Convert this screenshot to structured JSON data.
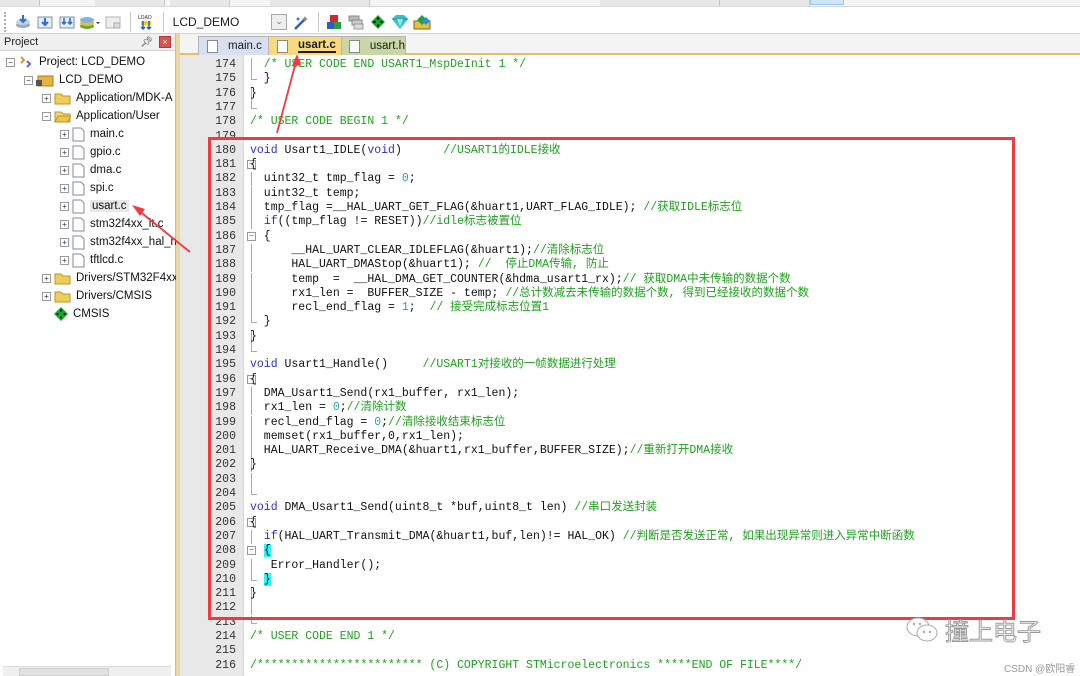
{
  "toolbar": {
    "target_name": "LCD_DEMO",
    "icons": [
      "rebuild-icon",
      "build-icon",
      "batch-build-icon",
      "translate-icon",
      "stop-build-icon",
      "load-download-icon"
    ],
    "right_icons": [
      "options-wand-icon",
      "manage-components-icon",
      "multi-project-icon",
      "pack-installer-icon",
      "select-software-packs-icon",
      "run-time-env-icon"
    ]
  },
  "project_panel": {
    "title": "Project",
    "pin_glyph": "⌖",
    "close_glyph": "×",
    "tree": [
      {
        "label": "Project: LCD_DEMO",
        "level": 0,
        "expander": "−",
        "icon": "project-icon"
      },
      {
        "label": "LCD_DEMO",
        "level": 1,
        "expander": "−",
        "icon": "target-folder-icon"
      },
      {
        "label": "Application/MDK-A",
        "level": 2,
        "expander": "+",
        "icon": "folder-icon"
      },
      {
        "label": "Application/User",
        "level": 2,
        "expander": "−",
        "icon": "folder-open-icon"
      },
      {
        "label": "main.c",
        "level": 3,
        "expander": "+",
        "icon": "file-icon"
      },
      {
        "label": "gpio.c",
        "level": 3,
        "expander": "+",
        "icon": "file-icon"
      },
      {
        "label": "dma.c",
        "level": 3,
        "expander": "+",
        "icon": "file-icon"
      },
      {
        "label": "spi.c",
        "level": 3,
        "expander": "+",
        "icon": "file-icon"
      },
      {
        "label": "usart.c",
        "level": 3,
        "expander": "+",
        "icon": "file-icon",
        "selected": true
      },
      {
        "label": "stm32f4xx_it.c",
        "level": 3,
        "expander": "+",
        "icon": "file-icon"
      },
      {
        "label": "stm32f4xx_hal_n",
        "level": 3,
        "expander": "+",
        "icon": "file-icon"
      },
      {
        "label": "tftlcd.c",
        "level": 3,
        "expander": "+",
        "icon": "file-icon"
      },
      {
        "label": "Drivers/STM32F4xx_",
        "level": 2,
        "expander": "+",
        "icon": "folder-icon"
      },
      {
        "label": "Drivers/CMSIS",
        "level": 2,
        "expander": "+",
        "icon": "folder-icon"
      },
      {
        "label": "CMSIS",
        "level": 2,
        "expander": "",
        "icon": "cmsis-diamond-icon"
      }
    ]
  },
  "tabs": [
    {
      "label": "main.c",
      "active": false
    },
    {
      "label": "usart.c",
      "active": true
    },
    {
      "label": "usart.h",
      "active": false
    }
  ],
  "editor": {
    "lines": [
      {
        "n": "174",
        "fold": "line",
        "segs": [
          [
            "c",
            "  /* USER CODE END USART1_MspDeInit 1 */"
          ]
        ]
      },
      {
        "n": "175",
        "fold": "end",
        "segs": [
          [
            "p",
            "  }"
          ]
        ]
      },
      {
        "n": "176",
        "fold": "line",
        "segs": [
          [
            "p",
            "}"
          ]
        ]
      },
      {
        "n": "177",
        "fold": "end",
        "segs": []
      },
      {
        "n": "178",
        "fold": "",
        "segs": [
          [
            "c",
            "/* USER CODE BEGIN 1 */"
          ]
        ]
      },
      {
        "n": "179",
        "fold": "",
        "segs": []
      },
      {
        "n": "180",
        "fold": "",
        "segs": [
          [
            "k",
            "void"
          ],
          [
            "p",
            " Usart1_IDLE("
          ],
          [
            "k",
            "void"
          ],
          [
            "p",
            ")      "
          ],
          [
            "c",
            "//USART1的IDLE接收"
          ]
        ]
      },
      {
        "n": "181",
        "fold": "box",
        "segs": [
          [
            "p",
            "{"
          ]
        ]
      },
      {
        "n": "182",
        "fold": "line",
        "segs": [
          [
            "p",
            "  uint32_t tmp_flag = "
          ],
          [
            "n",
            "0"
          ],
          [
            "p",
            ";"
          ]
        ]
      },
      {
        "n": "183",
        "fold": "line",
        "segs": [
          [
            "p",
            "  uint32_t temp;"
          ]
        ]
      },
      {
        "n": "184",
        "fold": "line",
        "segs": [
          [
            "p",
            "  tmp_flag =__HAL_UART_GET_FLAG(&huart1,UART_FLAG_IDLE); "
          ],
          [
            "c",
            "//获取IDLE标志位"
          ]
        ]
      },
      {
        "n": "185",
        "fold": "line",
        "segs": [
          [
            "p",
            "  "
          ],
          [
            "k",
            "if"
          ],
          [
            "p",
            "((tmp_flag != RESET))"
          ],
          [
            "c",
            "//idle标志被置位"
          ]
        ]
      },
      {
        "n": "186",
        "fold": "box",
        "segs": [
          [
            "p",
            "  {"
          ]
        ]
      },
      {
        "n": "187",
        "fold": "line",
        "segs": [
          [
            "p",
            "      __HAL_UART_CLEAR_IDLEFLAG(&huart1);"
          ],
          [
            "c",
            "//清除标志位"
          ]
        ]
      },
      {
        "n": "188",
        "fold": "line",
        "segs": [
          [
            "p",
            "      HAL_UART_DMAStop(&huart1); "
          ],
          [
            "c",
            "//  停止DMA传输, 防止"
          ]
        ]
      },
      {
        "n": "189",
        "fold": "line",
        "segs": [
          [
            "p",
            "      temp  =  __HAL_DMA_GET_COUNTER(&hdma_usart1_rx);"
          ],
          [
            "c",
            "// 获取DMA中未传输的数据个数"
          ]
        ]
      },
      {
        "n": "190",
        "fold": "line",
        "segs": [
          [
            "p",
            "      rx1_len =  BUFFER_SIZE - temp; "
          ],
          [
            "c",
            "//总计数减去未传输的数据个数, 得到已经接收的数据个数"
          ]
        ]
      },
      {
        "n": "191",
        "fold": "line",
        "segs": [
          [
            "p",
            "      recl_end_flag = "
          ],
          [
            "n",
            "1"
          ],
          [
            "p",
            ";  "
          ],
          [
            "c",
            "// 接受完成标志位置1"
          ]
        ]
      },
      {
        "n": "192",
        "fold": "end",
        "segs": [
          [
            "p",
            "  }"
          ]
        ]
      },
      {
        "n": "193",
        "fold": "line",
        "segs": [
          [
            "p",
            "}"
          ]
        ]
      },
      {
        "n": "194",
        "fold": "end",
        "segs": []
      },
      {
        "n": "195",
        "fold": "",
        "segs": [
          [
            "k",
            "void"
          ],
          [
            "p",
            " Usart1_Handle()     "
          ],
          [
            "c",
            "//USART1对接收的一帧数据进行处理"
          ]
        ]
      },
      {
        "n": "196",
        "fold": "box",
        "segs": [
          [
            "p",
            "{"
          ]
        ]
      },
      {
        "n": "197",
        "fold": "line",
        "segs": [
          [
            "p",
            "  DMA_Usart1_Send(rx1_buffer, rx1_len);"
          ]
        ]
      },
      {
        "n": "198",
        "fold": "line",
        "segs": [
          [
            "p",
            "  rx1_len = "
          ],
          [
            "n",
            "0"
          ],
          [
            "p",
            ";"
          ],
          [
            "c",
            "//清除计数"
          ]
        ]
      },
      {
        "n": "199",
        "fold": "line",
        "segs": [
          [
            "p",
            "  recl_end_flag = "
          ],
          [
            "n",
            "0"
          ],
          [
            "p",
            ";"
          ],
          [
            "c",
            "//清除接收结束标志位"
          ]
        ]
      },
      {
        "n": "200",
        "fold": "line",
        "segs": [
          [
            "p",
            "  memset(rx1_buffer,0,rx1_len);"
          ]
        ]
      },
      {
        "n": "201",
        "fold": "line",
        "segs": [
          [
            "p",
            "  HAL_UART_Receive_DMA(&huart1,rx1_buffer,BUFFER_SIZE);"
          ],
          [
            "c",
            "//重新打开DMA接收"
          ]
        ]
      },
      {
        "n": "202",
        "fold": "line",
        "segs": [
          [
            "p",
            "}"
          ]
        ]
      },
      {
        "n": "203",
        "fold": "line",
        "segs": []
      },
      {
        "n": "204",
        "fold": "end",
        "segs": []
      },
      {
        "n": "205",
        "fold": "",
        "segs": [
          [
            "k",
            "void"
          ],
          [
            "p",
            " DMA_Usart1_Send(uint8_t *buf,uint8_t len) "
          ],
          [
            "c",
            "//串口发送封装"
          ]
        ]
      },
      {
        "n": "206",
        "fold": "box",
        "segs": [
          [
            "p",
            "{"
          ]
        ]
      },
      {
        "n": "207",
        "fold": "line",
        "segs": [
          [
            "p",
            "  "
          ],
          [
            "k",
            "if"
          ],
          [
            "p",
            "(HAL_UART_Transmit_DMA(&huart1,buf,len)!= HAL_OK) "
          ],
          [
            "c",
            "//判断是否发送正常, 如果出现异常则进入异常中断函数"
          ]
        ]
      },
      {
        "n": "208",
        "fold": "box",
        "segs": [
          [
            "p",
            "  "
          ],
          [
            "h",
            "{"
          ]
        ]
      },
      {
        "n": "209",
        "fold": "line",
        "segs": [
          [
            "p",
            "   Error_Handler();"
          ]
        ]
      },
      {
        "n": "210",
        "fold": "end",
        "segs": [
          [
            "p",
            "  "
          ],
          [
            "h",
            "}"
          ]
        ]
      },
      {
        "n": "211",
        "fold": "line",
        "segs": [
          [
            "p",
            "}"
          ]
        ]
      },
      {
        "n": "212",
        "fold": "line",
        "segs": []
      },
      {
        "n": "213",
        "fold": "end",
        "segs": []
      },
      {
        "n": "214",
        "fold": "",
        "segs": [
          [
            "c",
            "/* USER CODE END 1 */"
          ]
        ]
      },
      {
        "n": "215",
        "fold": "",
        "segs": []
      },
      {
        "n": "216",
        "fold": "",
        "segs": [
          [
            "c",
            "/************************ (C) COPYRIGHT STMicroelectronics *****END OF FILE****/"
          ]
        ]
      }
    ]
  },
  "annotations": {
    "highlight_color": "#f03a3f",
    "watermark_text": "撞上电子",
    "credit": "CSDN @欧阳睿"
  }
}
